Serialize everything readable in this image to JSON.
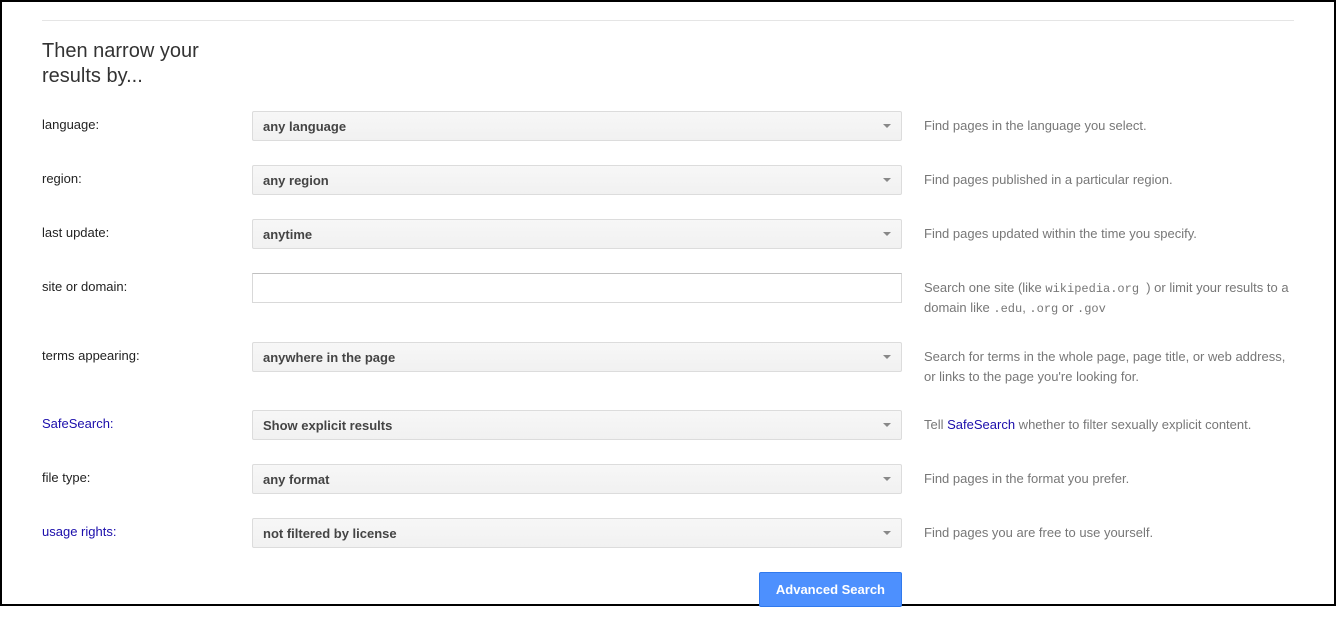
{
  "section_title": "Then narrow your results by...",
  "rows": {
    "language": {
      "label": "language:",
      "value": "any language",
      "desc": "Find pages in the language you select."
    },
    "region": {
      "label": "region:",
      "value": "any region",
      "desc": "Find pages published in a particular region."
    },
    "last_update": {
      "label": "last update:",
      "value": "anytime",
      "desc": "Find pages updated within the time you specify."
    },
    "site": {
      "label": "site or domain:",
      "value": "",
      "desc_before": "Search one site (like ",
      "desc_code1": " wikipedia.org ",
      "desc_mid": ") or limit your results to a domain like ",
      "desc_code2": ".edu",
      "desc_sep1": ", ",
      "desc_code3": ".org",
      "desc_sep2": " or ",
      "desc_code4": ".gov"
    },
    "terms": {
      "label": "terms appearing:",
      "value": "anywhere in the page",
      "desc": "Search for terms in the whole page, page title, or web address, or links to the page you're looking for."
    },
    "safesearch": {
      "label": "SafeSearch:",
      "value": "Show explicit results",
      "desc_before": "Tell ",
      "desc_link": "SafeSearch",
      "desc_after": " whether to filter sexually explicit content."
    },
    "filetype": {
      "label": "file type:",
      "value": "any format",
      "desc": "Find pages in the format you prefer."
    },
    "usage": {
      "label": "usage rights:",
      "value": "not filtered by license",
      "desc": "Find pages you are free to use yourself."
    }
  },
  "submit_label": "Advanced Search"
}
